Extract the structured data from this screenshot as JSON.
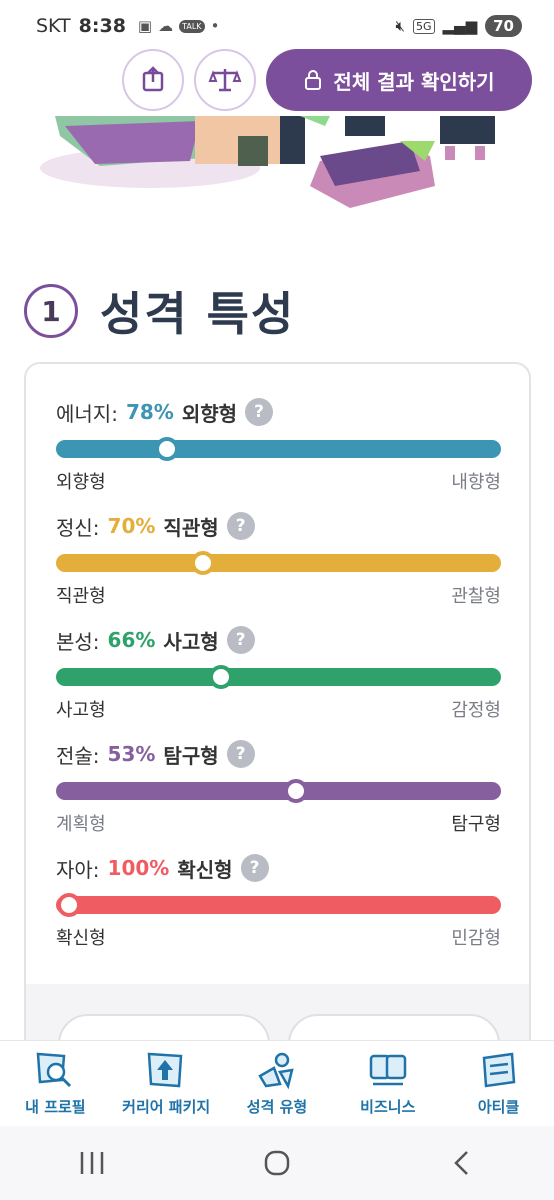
{
  "status": {
    "carrier": "SKT",
    "time": "8:38",
    "battery": "70",
    "network": "5G",
    "talk": "TALK"
  },
  "header": {
    "result_button_label": "전체 결과 확인하기"
  },
  "section": {
    "number": "1",
    "title": "성격 특성"
  },
  "traits": [
    {
      "category": "에너지:",
      "percent": "78%",
      "type": "외향형",
      "left_label": "외향형",
      "right_label": "내향형",
      "color": "#3b95b3",
      "value": 0.25,
      "highlight": "left"
    },
    {
      "category": "정신:",
      "percent": "70%",
      "type": "직관형",
      "left_label": "직관형",
      "right_label": "관찰형",
      "color": "#e4ae3a",
      "value": 0.33,
      "highlight": "left"
    },
    {
      "category": "본성:",
      "percent": "66%",
      "type": "사고형",
      "left_label": "사고형",
      "right_label": "감정형",
      "color": "#2fa26b",
      "value": 0.37,
      "highlight": "left"
    },
    {
      "category": "전술:",
      "percent": "53%",
      "type": "탐구형",
      "left_label": "계획형",
      "right_label": "탐구형",
      "color": "#86609e",
      "value": 0.54,
      "highlight": "right"
    },
    {
      "category": "자아:",
      "percent": "100%",
      "type": "확신형",
      "left_label": "확신형",
      "right_label": "민감형",
      "color": "#ef5d62",
      "value": 0.03,
      "highlight": "left"
    }
  ],
  "help_glyph": "?",
  "bottom_nav": [
    {
      "label": "내 프로필",
      "icon": "profile-search-icon"
    },
    {
      "label": "커리어 패키지",
      "icon": "career-package-icon"
    },
    {
      "label": "성격 유형",
      "icon": "personality-types-icon"
    },
    {
      "label": "비즈니스",
      "icon": "business-icon"
    },
    {
      "label": "아티클",
      "icon": "article-icon"
    }
  ]
}
